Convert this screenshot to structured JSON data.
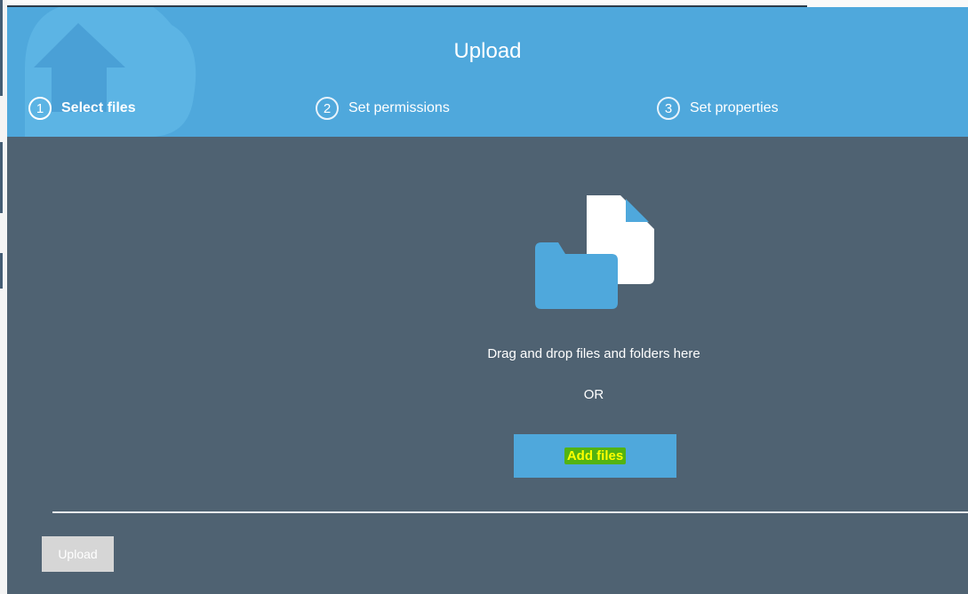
{
  "header": {
    "title": "Upload",
    "steps": [
      {
        "number": "1",
        "label": "Select files",
        "active": true
      },
      {
        "number": "2",
        "label": "Set permissions",
        "active": false
      },
      {
        "number": "3",
        "label": "Set properties",
        "active": false
      }
    ]
  },
  "main": {
    "drop_text": "Drag and drop files and folders here",
    "or_text": "OR",
    "add_files_label": "Add files"
  },
  "footer": {
    "upload_label": "Upload"
  },
  "colors": {
    "header_bg": "#4fa8dc",
    "body_bg": "#4f6272",
    "highlight_text": "#ffff00",
    "highlight_bg": "#53b312"
  },
  "icons": {
    "logo": "cloud-upload-icon",
    "illustration": "folder-file-icon"
  }
}
